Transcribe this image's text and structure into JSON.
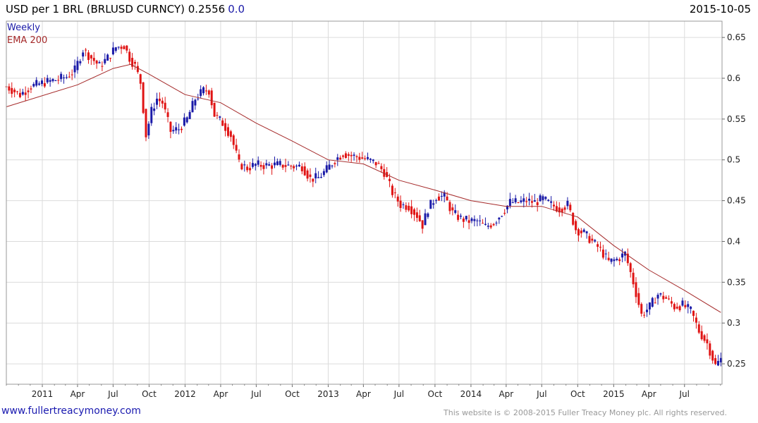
{
  "header": {
    "title": "USD per 1 BRL (BRLUSD CURNCY) 0.2556",
    "change": "0.0",
    "date": "2015-10-05"
  },
  "legend": {
    "period": "Weekly",
    "indicator": "EMA 200"
  },
  "footer": {
    "site": "www.fullertreacymoney.com",
    "copyright": "This website is © 2008-2015 Fuller Treacy Money plc. All rights reserved."
  },
  "colors": {
    "up": "#1a1aa8",
    "down": "#e01414",
    "ema": "#a52a2a",
    "grid": "#dcdcdc"
  },
  "chart_data": {
    "type": "candlestick",
    "frequency": "weekly",
    "ylim": [
      0.225,
      0.67
    ],
    "y_ticks": [
      0.25,
      0.3,
      0.35,
      0.4,
      0.45,
      0.5,
      0.55,
      0.6,
      0.65
    ],
    "x_range": [
      "2010-10-01",
      "2015-10-05"
    ],
    "x_ticks": [
      {
        "label": "2011",
        "date": "2011-01-01"
      },
      {
        "label": "Apr",
        "date": "2011-04-01"
      },
      {
        "label": "Jul",
        "date": "2011-07-01"
      },
      {
        "label": "Oct",
        "date": "2011-10-01"
      },
      {
        "label": "2012",
        "date": "2012-01-01"
      },
      {
        "label": "Apr",
        "date": "2012-04-01"
      },
      {
        "label": "Jul",
        "date": "2012-07-01"
      },
      {
        "label": "Oct",
        "date": "2012-10-01"
      },
      {
        "label": "2013",
        "date": "2013-01-01"
      },
      {
        "label": "Apr",
        "date": "2013-04-01"
      },
      {
        "label": "Jul",
        "date": "2013-07-01"
      },
      {
        "label": "Oct",
        "date": "2013-10-01"
      },
      {
        "label": "2014",
        "date": "2014-01-01"
      },
      {
        "label": "Apr",
        "date": "2014-04-01"
      },
      {
        "label": "Jul",
        "date": "2014-07-01"
      },
      {
        "label": "Oct",
        "date": "2014-10-01"
      },
      {
        "label": "2015",
        "date": "2015-01-01"
      },
      {
        "label": "Apr",
        "date": "2015-04-01"
      },
      {
        "label": "Jul",
        "date": "2015-07-01"
      }
    ],
    "price_path": [
      [
        "2010-10-01",
        0.59
      ],
      [
        "2010-11-05",
        0.58
      ],
      [
        "2010-12-03",
        0.59
      ],
      [
        "2011-01-07",
        0.595
      ],
      [
        "2011-02-04",
        0.598
      ],
      [
        "2011-03-04",
        0.602
      ],
      [
        "2011-03-25",
        0.61
      ],
      [
        "2011-04-15",
        0.635
      ],
      [
        "2011-05-06",
        0.625
      ],
      [
        "2011-05-27",
        0.615
      ],
      [
        "2011-06-17",
        0.625
      ],
      [
        "2011-07-08",
        0.638
      ],
      [
        "2011-07-29",
        0.64
      ],
      [
        "2011-08-12",
        0.625
      ],
      [
        "2011-08-26",
        0.615
      ],
      [
        "2011-09-09",
        0.595
      ],
      [
        "2011-09-23",
        0.53
      ],
      [
        "2011-10-07",
        0.56
      ],
      [
        "2011-10-21",
        0.575
      ],
      [
        "2011-11-04",
        0.57
      ],
      [
        "2011-11-25",
        0.535
      ],
      [
        "2011-12-16",
        0.538
      ],
      [
        "2012-01-06",
        0.55
      ],
      [
        "2012-01-27",
        0.575
      ],
      [
        "2012-02-17",
        0.585
      ],
      [
        "2012-03-02",
        0.585
      ],
      [
        "2012-03-16",
        0.555
      ],
      [
        "2012-04-06",
        0.545
      ],
      [
        "2012-04-27",
        0.53
      ],
      [
        "2012-05-18",
        0.495
      ],
      [
        "2012-06-08",
        0.49
      ],
      [
        "2012-06-29",
        0.494
      ],
      [
        "2012-07-27",
        0.493
      ],
      [
        "2012-08-31",
        0.494
      ],
      [
        "2012-10-05",
        0.492
      ],
      [
        "2012-10-26",
        0.492
      ],
      [
        "2012-11-16",
        0.477
      ],
      [
        "2012-12-07",
        0.478
      ],
      [
        "2012-12-28",
        0.488
      ],
      [
        "2013-01-18",
        0.5
      ],
      [
        "2013-02-08",
        0.508
      ],
      [
        "2013-03-01",
        0.505
      ],
      [
        "2013-03-22",
        0.503
      ],
      [
        "2013-04-12",
        0.5
      ],
      [
        "2013-05-03",
        0.496
      ],
      [
        "2013-05-24",
        0.485
      ],
      [
        "2013-06-14",
        0.46
      ],
      [
        "2013-07-05",
        0.445
      ],
      [
        "2013-07-26",
        0.443
      ],
      [
        "2013-08-16",
        0.432
      ],
      [
        "2013-08-30",
        0.42
      ],
      [
        "2013-09-13",
        0.44
      ],
      [
        "2013-10-04",
        0.455
      ],
      [
        "2013-10-25",
        0.455
      ],
      [
        "2013-11-15",
        0.435
      ],
      [
        "2013-12-06",
        0.428
      ],
      [
        "2013-12-27",
        0.425
      ],
      [
        "2014-01-17",
        0.425
      ],
      [
        "2014-02-07",
        0.418
      ],
      [
        "2014-02-28",
        0.423
      ],
      [
        "2014-03-21",
        0.435
      ],
      [
        "2014-04-11",
        0.448
      ],
      [
        "2014-05-02",
        0.448
      ],
      [
        "2014-05-23",
        0.45
      ],
      [
        "2014-06-13",
        0.448
      ],
      [
        "2014-07-04",
        0.452
      ],
      [
        "2014-07-25",
        0.445
      ],
      [
        "2014-08-15",
        0.44
      ],
      [
        "2014-09-05",
        0.445
      ],
      [
        "2014-09-26",
        0.415
      ],
      [
        "2014-10-17",
        0.41
      ],
      [
        "2014-11-07",
        0.4
      ],
      [
        "2014-11-28",
        0.39
      ],
      [
        "2014-12-19",
        0.375
      ],
      [
        "2015-01-09",
        0.378
      ],
      [
        "2015-01-30",
        0.385
      ],
      [
        "2015-02-20",
        0.35
      ],
      [
        "2015-03-13",
        0.31
      ],
      [
        "2015-04-03",
        0.32
      ],
      [
        "2015-04-24",
        0.335
      ],
      [
        "2015-05-15",
        0.33
      ],
      [
        "2015-06-05",
        0.32
      ],
      [
        "2015-06-26",
        0.322
      ],
      [
        "2015-07-17",
        0.315
      ],
      [
        "2015-08-07",
        0.29
      ],
      [
        "2015-08-28",
        0.275
      ],
      [
        "2015-09-18",
        0.248
      ],
      [
        "2015-10-02",
        0.2556
      ]
    ],
    "ema_path": [
      [
        "2010-10-01",
        0.565
      ],
      [
        "2011-04-01",
        0.592
      ],
      [
        "2011-07-01",
        0.612
      ],
      [
        "2011-08-15",
        0.617
      ],
      [
        "2011-10-01",
        0.605
      ],
      [
        "2012-01-01",
        0.58
      ],
      [
        "2012-04-01",
        0.57
      ],
      [
        "2012-07-01",
        0.545
      ],
      [
        "2012-10-01",
        0.523
      ],
      [
        "2013-01-01",
        0.5
      ],
      [
        "2013-04-01",
        0.495
      ],
      [
        "2013-07-01",
        0.475
      ],
      [
        "2013-10-01",
        0.463
      ],
      [
        "2014-01-01",
        0.45
      ],
      [
        "2014-04-01",
        0.443
      ],
      [
        "2014-07-01",
        0.443
      ],
      [
        "2014-10-01",
        0.43
      ],
      [
        "2015-01-01",
        0.395
      ],
      [
        "2015-04-01",
        0.365
      ],
      [
        "2015-07-01",
        0.34
      ],
      [
        "2015-10-02",
        0.313
      ]
    ]
  }
}
